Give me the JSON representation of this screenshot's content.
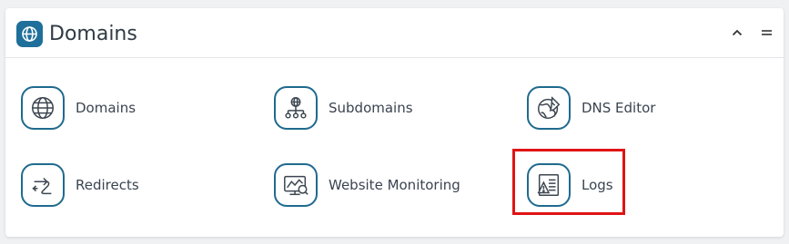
{
  "panel": {
    "title": "Domains",
    "header_icon": "globe-icon",
    "actions": [
      {
        "name": "collapse",
        "icon": "chevron-up-icon"
      },
      {
        "name": "menu",
        "icon": "hamburger-icon"
      }
    ]
  },
  "tiles": [
    {
      "label": "Domains",
      "icon": "globe-icon"
    },
    {
      "label": "Subdomains",
      "icon": "network-icon"
    },
    {
      "label": "DNS Editor",
      "icon": "globe-edit-icon"
    },
    {
      "label": "Redirects",
      "icon": "redirect-arrows-icon"
    },
    {
      "label": "Website Monitoring",
      "icon": "monitor-chart-icon"
    },
    {
      "label": "Logs",
      "icon": "log-warning-icon"
    }
  ],
  "colors": {
    "accent": "#1e6f9a",
    "icon_stroke": "#1f6a8e",
    "icon_glyph": "#3c4650",
    "highlight": "#e01414"
  }
}
